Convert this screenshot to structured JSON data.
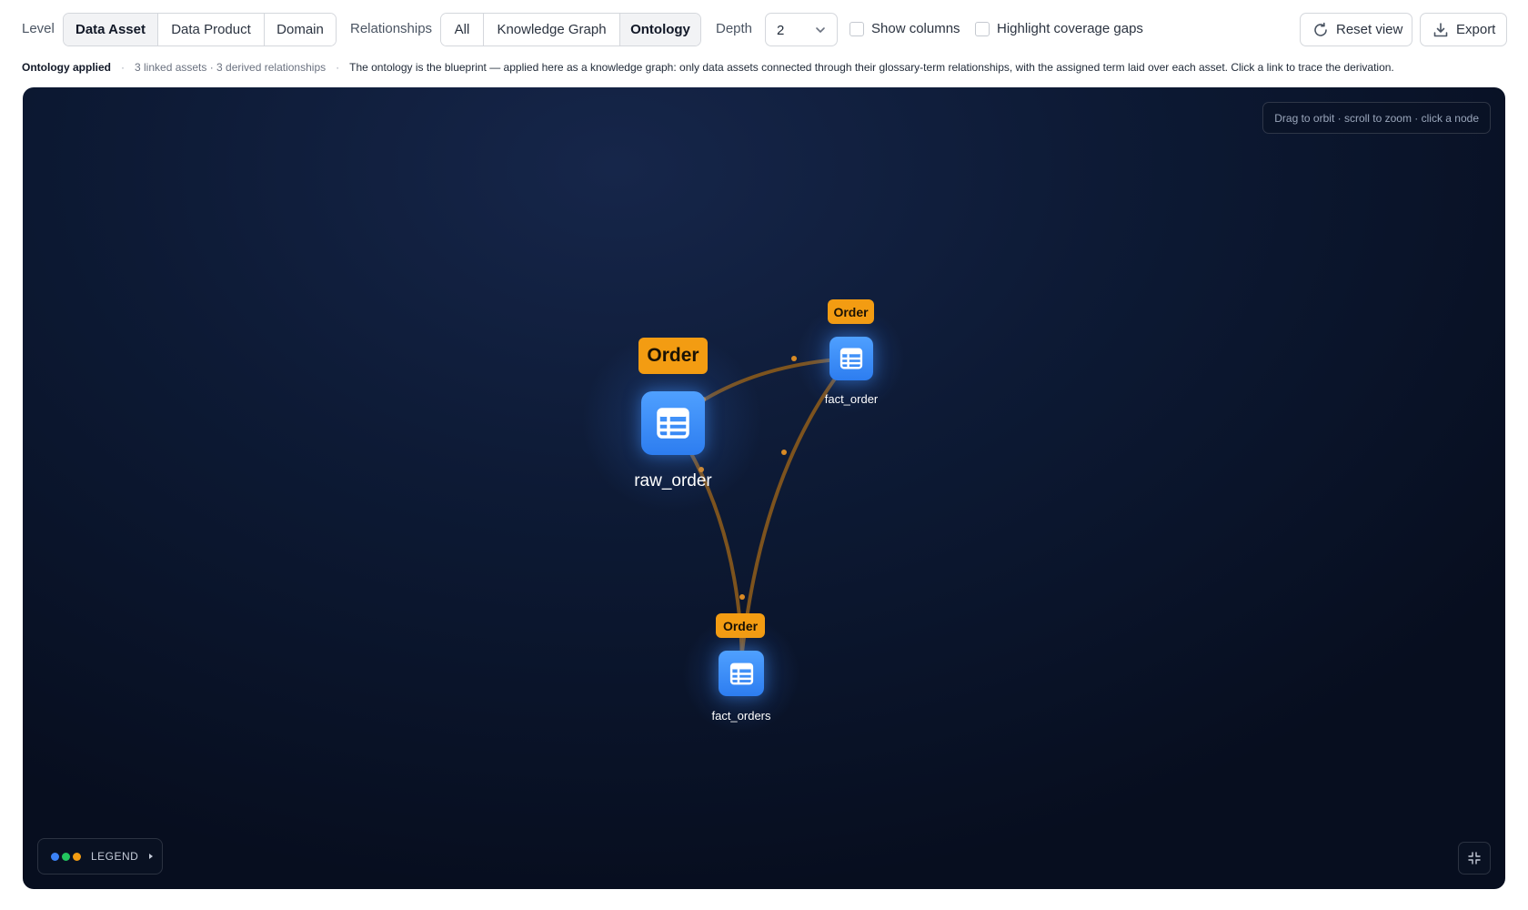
{
  "toolbar": {
    "level_label": "Level",
    "level_options": [
      "Data Asset",
      "Data Product",
      "Domain"
    ],
    "level_selected": "Data Asset",
    "relationships_label": "Relationships",
    "relationship_options": [
      "All",
      "Knowledge Graph",
      "Ontology"
    ],
    "relationship_selected": "Ontology",
    "depth_label": "Depth",
    "depth_value": "2",
    "show_columns_label": "Show columns",
    "highlight_gaps_label": "Highlight coverage gaps",
    "reset_label": "Reset view",
    "export_label": "Export"
  },
  "info": {
    "status": "Ontology applied",
    "counts": "3 linked assets · 3 derived relationships",
    "description": "The ontology is the blueprint — applied here as a knowledge graph: only data assets connected through their glossary-term relationships, with the assigned term laid over each asset. Click a link to trace the derivation."
  },
  "canvas": {
    "hint": "Drag to orbit · scroll to zoom · click a node",
    "legend_label": "LEGEND",
    "legend_colors": [
      "#3b82f6",
      "#22c55e",
      "#f39c12"
    ],
    "edge_color": "#8a5a1c",
    "node_color": "#3b8ef5",
    "term_color": "#f39c12"
  },
  "graph": {
    "nodes": [
      {
        "name": "raw_order",
        "term": "Order",
        "icon": "table-icon"
      },
      {
        "name": "fact_order",
        "term": "Order",
        "icon": "table-icon"
      },
      {
        "name": "fact_orders",
        "term": "Order",
        "icon": "table-icon"
      }
    ]
  }
}
